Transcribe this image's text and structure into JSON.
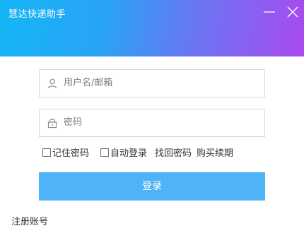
{
  "window": {
    "title": "慧达快递助手",
    "minimize_icon": "minimize-icon",
    "close_icon": "close-icon"
  },
  "form": {
    "username": {
      "placeholder": "用户名/邮箱",
      "value": "",
      "icon": "user-icon"
    },
    "password": {
      "placeholder": "密码",
      "value": "",
      "icon": "lock-icon"
    }
  },
  "options": {
    "remember_password": {
      "label": "记住密码",
      "checked": false
    },
    "auto_login": {
      "label": "自动登录",
      "checked": false
    },
    "find_password": "找回密码",
    "buy_renew": "购买续期"
  },
  "login_button": "登录",
  "register_link": "注册账号",
  "colors": {
    "gradient_start": "#14b6f6",
    "gradient_end": "#a94af0",
    "login_button": "#4fb3f7"
  }
}
